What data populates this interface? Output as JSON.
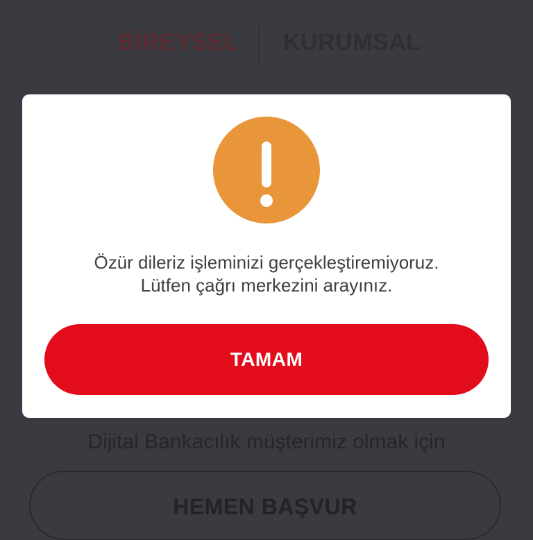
{
  "tabs": {
    "bireysel": "BİREYSEL",
    "kurumsal": "KURUMSAL"
  },
  "background": {
    "caption": "Dijital Bankacılık müşterimiz olmak için",
    "apply_label": "HEMEN BAŞVUR"
  },
  "dialog": {
    "icon": "exclamation-icon",
    "message_line1": "Özür dileriz işleminizi gerçekleştiremiyoruz.",
    "message_line2": "Lütfen çağrı merkezini arayınız.",
    "ok_label": "TAMAM"
  },
  "colors": {
    "accent_red": "#e30c1b",
    "warning_orange": "#e9963a",
    "overlay": "#3a3b41"
  }
}
